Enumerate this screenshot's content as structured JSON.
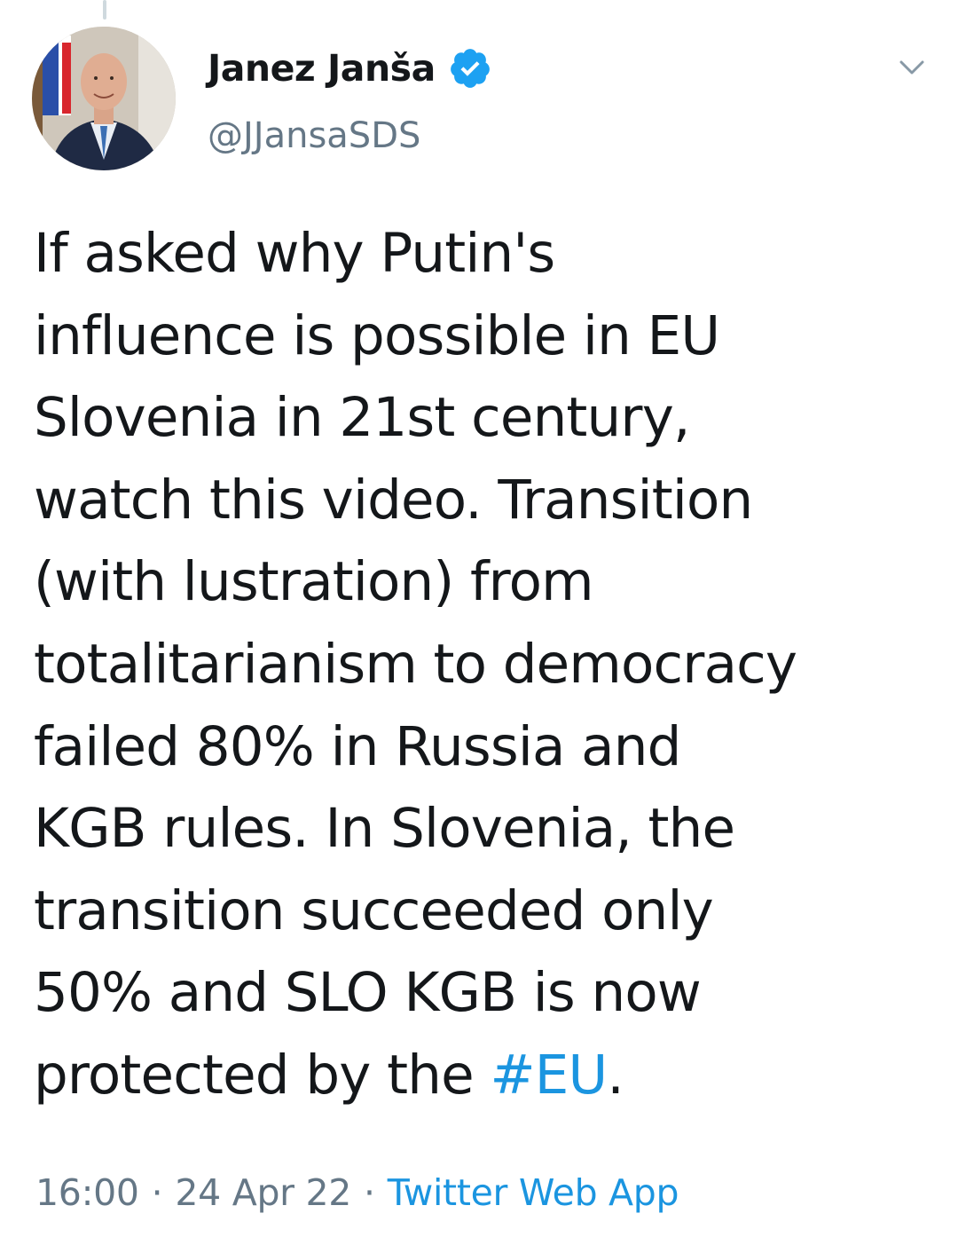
{
  "author": {
    "display_name": "Janez Janša",
    "handle": "@JJansaSDS",
    "verified": true
  },
  "icons": {
    "verified": "verified-badge-icon",
    "menu": "chevron-down-icon",
    "avatar": "profile-photo"
  },
  "tweet": {
    "lines": [
      "If asked why Putin's",
      "influence is possible in EU",
      "Slovenia in 21st century,",
      "watch this video. Transition",
      "(with lustration) from",
      "totalitarianism to democracy",
      "failed 80% in Russia and",
      "KGB rules. In Slovenia, the",
      "transition succeeded only",
      "50% and SLO KGB is now"
    ],
    "last_line_prefix": "protected by the ",
    "hashtag": "#EU",
    "last_line_suffix": "."
  },
  "meta": {
    "time": "16:00",
    "separator": "·",
    "date": "24 Apr 22",
    "source": "Twitter Web App"
  },
  "colors": {
    "link": "#1b95e0",
    "text": "#14171a",
    "secondary": "#657786",
    "verified": "#1da1f2"
  }
}
